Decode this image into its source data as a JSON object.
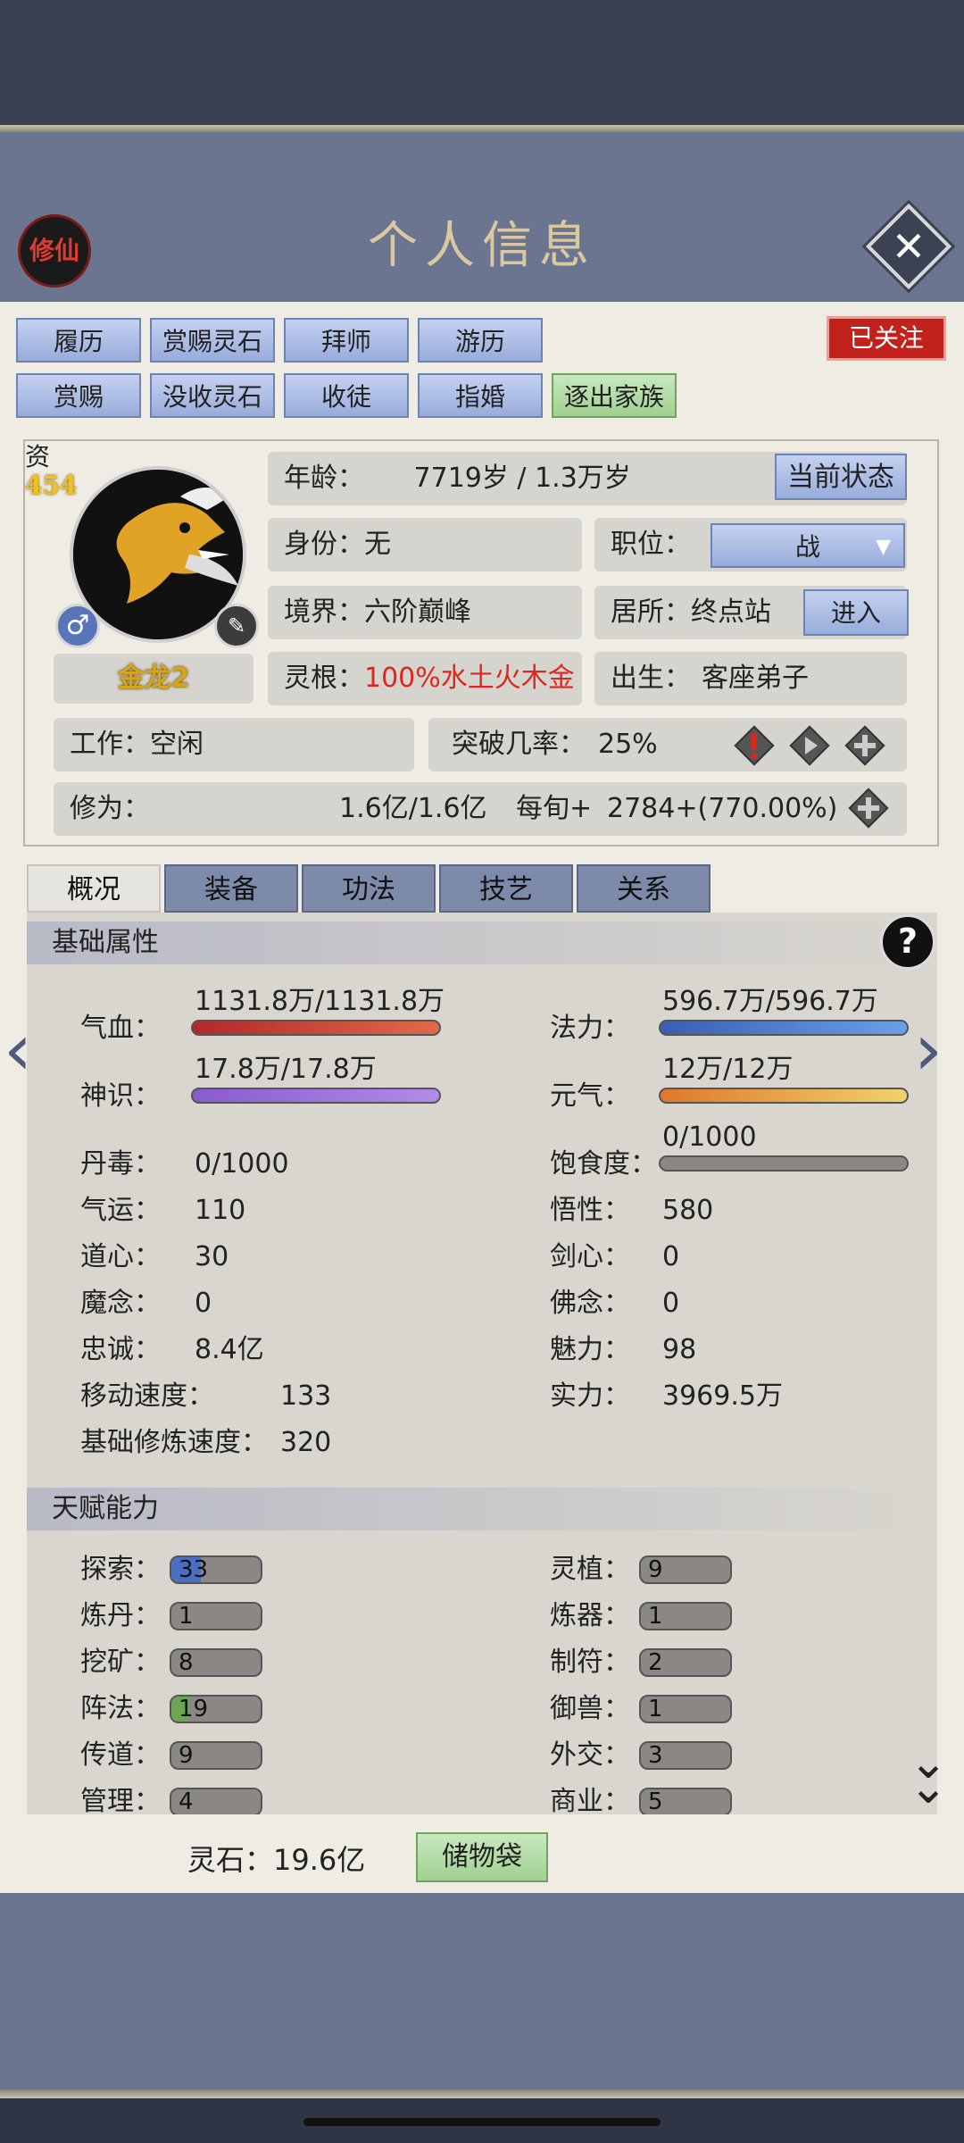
{
  "header": {
    "logo_text": "修仙",
    "title": "个人信息"
  },
  "top_buttons": {
    "row1": [
      "履历",
      "赏赐灵石",
      "拜师",
      "游历"
    ],
    "row2": [
      "赏赐",
      "没收灵石",
      "收徒",
      "指婚",
      "逐出家族"
    ],
    "followed": "已关注"
  },
  "profile": {
    "zi_label": "资",
    "zi_value": "454",
    "name": "金龙2",
    "age_label": "年龄：",
    "age_value": "7719岁 / 1.3万岁",
    "status_button": "当前状态",
    "identity_label": "身份：",
    "identity_value": "无",
    "position_label": "职位：",
    "position_value": "战",
    "realm_label": "境界：",
    "realm_value": "六阶巅峰",
    "residence_label": "居所：",
    "residence_value": "终点站",
    "enter_button": "进入",
    "root_label": "灵根：",
    "root_value": "100%水土火木金",
    "birth_label": "出生：",
    "birth_value": "客座弟子",
    "work_label": "工作：",
    "work_value": "空闲",
    "break_label": "突破几率：",
    "break_value": "25%",
    "cultivation_label": "修为：",
    "cultivation_value": "1.6亿/1.6亿",
    "per_turn_label": "每旬+",
    "per_turn_value": "2784+(770.00%)"
  },
  "tabs": [
    "概况",
    "装备",
    "功法",
    "技艺",
    "关系"
  ],
  "basic": {
    "title": "基础属性",
    "hp_label": "气血：",
    "hp_value": "1131.8万/1131.8万",
    "mp_label": "法力：",
    "mp_value": "596.7万/596.7万",
    "sense_label": "神识：",
    "sense_value": "17.8万/17.8万",
    "vital_label": "元气：",
    "vital_value": "12万/12万",
    "satiety_label": "饱食度：",
    "satiety_value": "0/1000",
    "rows": [
      {
        "l_label": "丹毒：",
        "l_value": "0/1000",
        "r_label": "",
        "r_value": ""
      },
      {
        "l_label": "气运：",
        "l_value": "110",
        "r_label": "悟性：",
        "r_value": "580"
      },
      {
        "l_label": "道心：",
        "l_value": "30",
        "r_label": "剑心：",
        "r_value": "0"
      },
      {
        "l_label": "魔念：",
        "l_value": "0",
        "r_label": "佛念：",
        "r_value": "0"
      },
      {
        "l_label": "忠诚：",
        "l_value": "8.4亿",
        "r_label": "魅力：",
        "r_value": "98"
      },
      {
        "l_label": "移动速度：",
        "l_value": "133",
        "r_label": "实力：",
        "r_value": "3969.5万"
      },
      {
        "l_label": "基础修炼速度：",
        "l_value": "320",
        "r_label": "",
        "r_value": ""
      }
    ]
  },
  "talent": {
    "title": "天赋能力",
    "rows": [
      {
        "l_label": "探索：",
        "l_value": "33",
        "r_label": "灵植：",
        "r_value": "9"
      },
      {
        "l_label": "炼丹：",
        "l_value": "1",
        "r_label": "炼器：",
        "r_value": "1"
      },
      {
        "l_label": "挖矿：",
        "l_value": "8",
        "r_label": "制符：",
        "r_value": "2"
      },
      {
        "l_label": "阵法：",
        "l_value": "19",
        "r_label": "御兽：",
        "r_value": "1"
      },
      {
        "l_label": "传道：",
        "l_value": "9",
        "r_label": "外交：",
        "r_value": "3"
      },
      {
        "l_label": "管理：",
        "l_value": "4",
        "r_label": "商业：",
        "r_value": "5"
      }
    ]
  },
  "footer": {
    "spirit_stone": "灵石：19.6亿",
    "bag": "储物袋"
  },
  "colors": {
    "hp": "#c0362f",
    "mp": "#4a78c9",
    "sense": "#9a6fd6",
    "vital": "#e0a03a",
    "explore": "#4a6fc0",
    "formation": "#6aa655"
  }
}
